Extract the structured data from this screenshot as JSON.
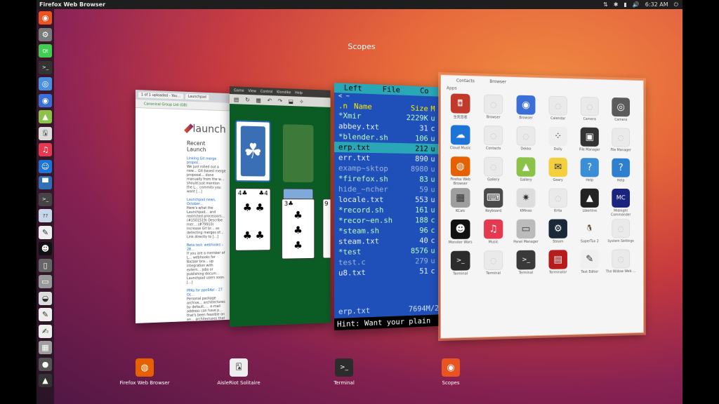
{
  "top_panel": {
    "title": "Firefox Web Browser",
    "time": "6:32 AM"
  },
  "scopes_title": "Scopes",
  "browser_window": {
    "tabs": [
      "1 of 1 uploaded - You…",
      "Launchpad"
    ],
    "url": "Canonical Group Ltd (GB)",
    "logo_text": "launch",
    "recent_heading": "Recent Launch",
    "items": [
      {
        "link": "Linking Git merge propos…",
        "text": "We just rolled out a new… Git-based merge proposal… done manually from the w… should just mention the L… commits you want […]"
      },
      {
        "link": "Launchpad news, October…",
        "text": "Here's what the Launchpad… and restricted processors… (#1501519) Describe mer… (#79910) Increase Git br… as detecting merges of… Link directly to […]"
      },
      {
        "link": "Beta test: webhooks – 28…",
        "text": "If you are a member of L… webhooks for Bazaar bra… up integration with extern… jobs or publishing docum… Launchpad users soon. […]"
      },
      {
        "link": "PPAs for ppc64el – 27 Oc…",
        "text": "Personal package archive… architectures by default, … e-mail address can have p… that's been feasible on an… architectures that Ubuntu…"
      }
    ]
  },
  "solitaire_window": {
    "menu": [
      "Game",
      "View",
      "Control",
      "Klondike",
      "Help"
    ]
  },
  "terminal_window": {
    "header": [
      "Left",
      "File",
      "Co"
    ],
    "path": "<  ~",
    "col_n": ".n",
    "col_name": "Name",
    "col_size": "Size",
    "col_mod": "M",
    "rows": [
      {
        "name": "*Xmir",
        "size": "2229K",
        "m": "u",
        "kind": "exec"
      },
      {
        "name": " abbey.txt",
        "size": "31",
        "m": "c",
        "kind": "normal"
      },
      {
        "name": "*blender.sh",
        "size": "106",
        "m": "u",
        "kind": "exec"
      },
      {
        "name": " erp.txt",
        "size": "212",
        "m": "u",
        "kind": "sel"
      },
      {
        "name": " err.txt",
        "size": "890",
        "m": "u",
        "kind": "normal"
      },
      {
        "name": " examp~sktop",
        "size": "8980",
        "m": "u",
        "kind": "dim"
      },
      {
        "name": "*firefox.sh",
        "size": "83",
        "m": "u",
        "kind": "exec"
      },
      {
        "name": " hide_~ncher",
        "size": "59",
        "m": "u",
        "kind": "dim"
      },
      {
        "name": " locale.txt",
        "size": "553",
        "m": "u",
        "kind": "normal"
      },
      {
        "name": "*record.sh",
        "size": "161",
        "m": "u",
        "kind": "exec"
      },
      {
        "name": "*recor~en.sh",
        "size": "188",
        "m": "c",
        "kind": "exec"
      },
      {
        "name": "*steam.sh",
        "size": "96",
        "m": "c",
        "kind": "exec"
      },
      {
        "name": " steam.txt",
        "size": "40",
        "m": "c",
        "kind": "normal"
      },
      {
        "name": "*test",
        "size": "8576",
        "m": "u",
        "kind": "exec"
      },
      {
        "name": " test.c",
        "size": "279",
        "m": "u",
        "kind": "dim"
      },
      {
        "name": " u8.txt",
        "size": "51",
        "m": "c",
        "kind": "normal"
      }
    ],
    "status_name": "erp.txt",
    "status_size": "7694M/2",
    "hint": "Hint: Want your plain"
  },
  "scopes_window": {
    "top_apps": [
      "Contacts",
      "Browser"
    ],
    "section": "Apps",
    "apps": [
      {
        "label": "生死音者",
        "icon": "mahjong-icon",
        "bg": "#c0392b",
        "glyph": "🀄"
      },
      {
        "label": "Browser",
        "icon": "blank",
        "bg": "",
        "glyph": "◌"
      },
      {
        "label": "Browser",
        "icon": "browser-icon",
        "bg": "#3b6fd6",
        "glyph": "◉"
      },
      {
        "label": "Calendar",
        "icon": "blank",
        "bg": "",
        "glyph": "◌"
      },
      {
        "label": "Camera",
        "icon": "blank",
        "bg": "",
        "glyph": "◌"
      },
      {
        "label": "Camera",
        "icon": "camera-icon",
        "bg": "#5b5b5b",
        "glyph": "◎"
      },
      {
        "label": "Cloud Music",
        "icon": "cloud-music-icon",
        "bg": "#1e73d6",
        "glyph": "☁"
      },
      {
        "label": "Contacts",
        "icon": "blank",
        "bg": "",
        "glyph": "◌"
      },
      {
        "label": "Dekko",
        "icon": "blank",
        "bg": "",
        "glyph": "◌"
      },
      {
        "label": "Dolly",
        "icon": "dolly-icon",
        "bg": "#eeeeee",
        "glyph": "⁘"
      },
      {
        "label": "File Manager",
        "icon": "file-manager-icon",
        "bg": "#333333",
        "glyph": "▣"
      },
      {
        "label": "File Manager",
        "icon": "blank",
        "bg": "",
        "glyph": "◌"
      },
      {
        "label": "Firefox Web Browser",
        "icon": "firefox-icon",
        "bg": "#e66000",
        "glyph": "◍"
      },
      {
        "label": "Gallery",
        "icon": "blank",
        "bg": "",
        "glyph": "◌"
      },
      {
        "label": "Gallery",
        "icon": "gallery-icon",
        "bg": "#8bc34a",
        "glyph": "▲"
      },
      {
        "label": "Geary",
        "icon": "geary-icon",
        "bg": "#f4d03f",
        "glyph": "✉"
      },
      {
        "label": "Help",
        "icon": "help-icon",
        "bg": "#3b8ed6",
        "glyph": "?"
      },
      {
        "label": "Help",
        "icon": "help-icon",
        "bg": "#2f7fd1",
        "glyph": "?"
      },
      {
        "label": "KCalc",
        "icon": "kcalc-icon",
        "bg": "#9e9e9e",
        "glyph": "▦"
      },
      {
        "label": "Keyboard",
        "icon": "keyboard-icon",
        "bg": "#4a4a4a",
        "glyph": "⌨"
      },
      {
        "label": "KMines",
        "icon": "kmines-icon",
        "bg": "#dddddd",
        "glyph": "✷"
      },
      {
        "label": "Krita",
        "icon": "blank",
        "bg": "",
        "glyph": "◌"
      },
      {
        "label": "Libertine",
        "icon": "libertine-icon",
        "bg": "#222222",
        "glyph": "▲"
      },
      {
        "label": "Midnight Commander",
        "icon": "mc-icon",
        "bg": "#1a237e",
        "glyph": "MC"
      },
      {
        "label": "Monster Wars",
        "icon": "monster-wars-icon",
        "bg": "#111111",
        "glyph": "☻"
      },
      {
        "label": "Music",
        "icon": "music-icon",
        "bg": "#e53950",
        "glyph": "♫"
      },
      {
        "label": "Panel Manager",
        "icon": "panel-manager-icon",
        "bg": "#bbbbbb",
        "glyph": "▭"
      },
      {
        "label": "Steam",
        "icon": "steam-icon",
        "bg": "#1b2838",
        "glyph": "⚙"
      },
      {
        "label": "SuperTux 2",
        "icon": "supertux-icon",
        "bg": "#f5f5f5",
        "glyph": "🐧"
      },
      {
        "label": "System Settings",
        "icon": "blank",
        "bg": "",
        "glyph": "◌"
      },
      {
        "label": "Terminal",
        "icon": "terminal-icon",
        "bg": "#2c2c2c",
        "glyph": ">_"
      },
      {
        "label": "Terminal",
        "icon": "blank",
        "bg": "",
        "glyph": "◌"
      },
      {
        "label": "Terminal",
        "icon": "terminal-icon",
        "bg": "#3a3a3a",
        "glyph": ">_"
      },
      {
        "label": "Terminator",
        "icon": "terminator-icon",
        "bg": "#b71c1c",
        "glyph": "▤"
      },
      {
        "label": "Text Editor",
        "icon": "text-editor-icon",
        "bg": "#f0f0f0",
        "glyph": "✎"
      },
      {
        "label": "The Widow Web …",
        "icon": "blank",
        "bg": "",
        "glyph": "◌"
      }
    ]
  },
  "dock": [
    {
      "label": "Firefox Web Browser",
      "icon": "firefox-icon",
      "bg": "#e66000",
      "glyph": "◍"
    },
    {
      "label": "AisleRiot Solitaire",
      "icon": "solitaire-icon",
      "bg": "#eeeeee",
      "glyph": "🂡"
    },
    {
      "label": "Terminal",
      "icon": "terminal-icon",
      "bg": "#2c2c2c",
      "glyph": ">_"
    },
    {
      "label": "Scopes",
      "icon": "ubuntu-icon",
      "bg": "#e95420",
      "glyph": "◉"
    }
  ],
  "launcher": [
    {
      "icon": "ubuntu-logo-icon",
      "bg": "#e95420",
      "glyph": "◉"
    },
    {
      "icon": "settings-icon",
      "bg": "#7a7a7a",
      "glyph": "⚙"
    },
    {
      "icon": "qt-creator-icon",
      "bg": "#41cd52",
      "glyph": "Qt"
    },
    {
      "icon": "terminal-icon",
      "bg": "#333333",
      "glyph": ">_"
    },
    {
      "icon": "chromium-icon",
      "bg": "#4a8fe0",
      "glyph": "◎"
    },
    {
      "icon": "browser-icon",
      "bg": "#3b6fd6",
      "glyph": "◉"
    },
    {
      "icon": "gallery-icon",
      "bg": "#8bc34a",
      "glyph": "▲"
    },
    {
      "icon": "solitaire-icon",
      "bg": "#dddddd",
      "glyph": "🂡"
    },
    {
      "icon": "music-icon",
      "bg": "#e53950",
      "glyph": "♫"
    },
    {
      "icon": "scopes-icon",
      "bg": "#1e73d6",
      "glyph": "☺"
    },
    {
      "icon": "tetris-icon",
      "bg": "#2f6fb8",
      "glyph": "▀"
    },
    {
      "icon": "terminal-icon",
      "bg": "#444444",
      "glyph": ">_"
    },
    {
      "icon": "calculator-icon",
      "bg": "#c7d7ea",
      "glyph": "??"
    },
    {
      "icon": "text-editor-icon",
      "bg": "#eeeeee",
      "glyph": "✎"
    },
    {
      "icon": "monster-icon",
      "bg": "#111111",
      "glyph": "☻"
    },
    {
      "icon": "window-icon",
      "bg": "#666666",
      "glyph": "▯"
    },
    {
      "icon": "panel-icon",
      "bg": "#999999",
      "glyph": "▭"
    },
    {
      "icon": "disk-icon",
      "bg": "#dddddd",
      "glyph": "◒"
    },
    {
      "icon": "editor-icon",
      "bg": "#eeeeee",
      "glyph": "✎"
    },
    {
      "icon": "notes-icon",
      "bg": "#eeeeee",
      "glyph": "✍"
    },
    {
      "icon": "kcalc-icon",
      "bg": "#9e9e9e",
      "glyph": "▦"
    },
    {
      "icon": "sphere-icon",
      "bg": "#555555",
      "glyph": "●"
    },
    {
      "icon": "tux-icon",
      "bg": "#333333",
      "glyph": "▲"
    }
  ]
}
